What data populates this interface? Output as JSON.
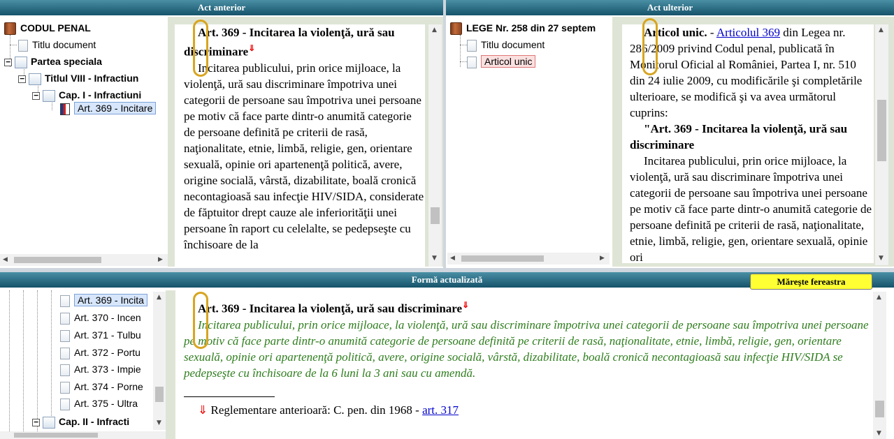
{
  "top_left": {
    "header": "Act anterior",
    "tree": [
      {
        "label": "CODUL PENAL"
      },
      {
        "label": "Titlu document"
      },
      {
        "label": "Partea speciala"
      },
      {
        "label": "Titlul VIII - Infractiun"
      },
      {
        "label": "Cap. I - Infractiuni"
      },
      {
        "label": "Art. 369 - Incitare"
      }
    ],
    "doc": {
      "title": "Art. 369 - Incitarea la violenţă, ură sau discriminare",
      "arrow": "⇓",
      "body": "Incitarea publicului, prin orice mijloace, la violenţă, ură sau discriminare împotriva unei categorii de persoane sau împotriva unei persoane pe motiv că face parte dintr-o anumită categorie de persoane definită pe criterii de rasă, naţionalitate, etnie, limbă, religie, gen, orientare sexuală, opinie ori apartenenţă politică, avere, origine socială, vârstă, dizabilitate, boală cronică necontagioasă sau infecţie HIV/SIDA, considerate de făptuitor drept cauze ale inferiorităţii unei persoane în raport cu celelalte, se pedepseşte cu închisoare de la"
    }
  },
  "top_right": {
    "header": "Act ulterior",
    "tree": [
      {
        "label": "LEGE Nr. 258 din 27 septem"
      },
      {
        "label": "Titlu document"
      },
      {
        "label": "Articol unic"
      }
    ],
    "doc": {
      "lead": "Articol unic.",
      "dash": " - ",
      "link": "Articolul 369",
      "intro": " din Legea nr. 286/2009 privind Codul penal, publicată în Monitorul Oficial al României, Partea I, nr. 510 din 24 iulie 2009, cu modificările şi completările ulterioare, se modifică şi va avea următorul cuprins:",
      "title": "\"Art. 369 - Incitarea la violenţă, ură sau discriminare",
      "body": "Incitarea publicului, prin orice mijloace, la violenţă, ură sau discriminare împotriva unei categorii de persoane sau împotriva unei persoane pe motiv că face parte dintr-o anumită categorie de persoane definită pe criterii de rasă, naţionalitate, etnie, limbă, religie, gen, orientare sexuală, opinie ori"
    }
  },
  "bottom": {
    "header": "Formă actualizată",
    "maximize_button": "Măreşte fereastra",
    "tree": [
      {
        "label": "Art. 369 - Incita"
      },
      {
        "label": "Art. 370 - Incen"
      },
      {
        "label": "Art. 371 - Tulbu"
      },
      {
        "label": "Art. 372 - Portu"
      },
      {
        "label": "Art. 373 - Impie"
      },
      {
        "label": "Art. 374 - Porne"
      },
      {
        "label": "Art. 375 - Ultra"
      },
      {
        "label": "Cap. II - Infracti"
      }
    ],
    "doc": {
      "title": "Art. 369 - Incitarea la violenţă, ură sau discriminare",
      "arrow": "⇓",
      "body": "Incitarea publicului, prin orice mijloace, la violenţă, ură sau discriminare împotriva unei categorii de persoane sau împotriva unei persoane pe motiv că face parte dintr-o anumită categorie de persoane definită pe criterii de rasă, naţionalitate, etnie, limbă, religie, gen, orientare sexuală, opinie ori apartenenţă politică, avere, origine socială, vârstă, dizabilitate, boală cronică necontagioasă sau infecţie HIV/SIDA se pedepseşte cu închisoare de la 6 luni la 3 ani sau cu amendă.",
      "prev_arrow": "⇓",
      "prev_text": "Reglementare anterioară: C. pen. din 1968 - ",
      "prev_link": "art. 317"
    }
  }
}
